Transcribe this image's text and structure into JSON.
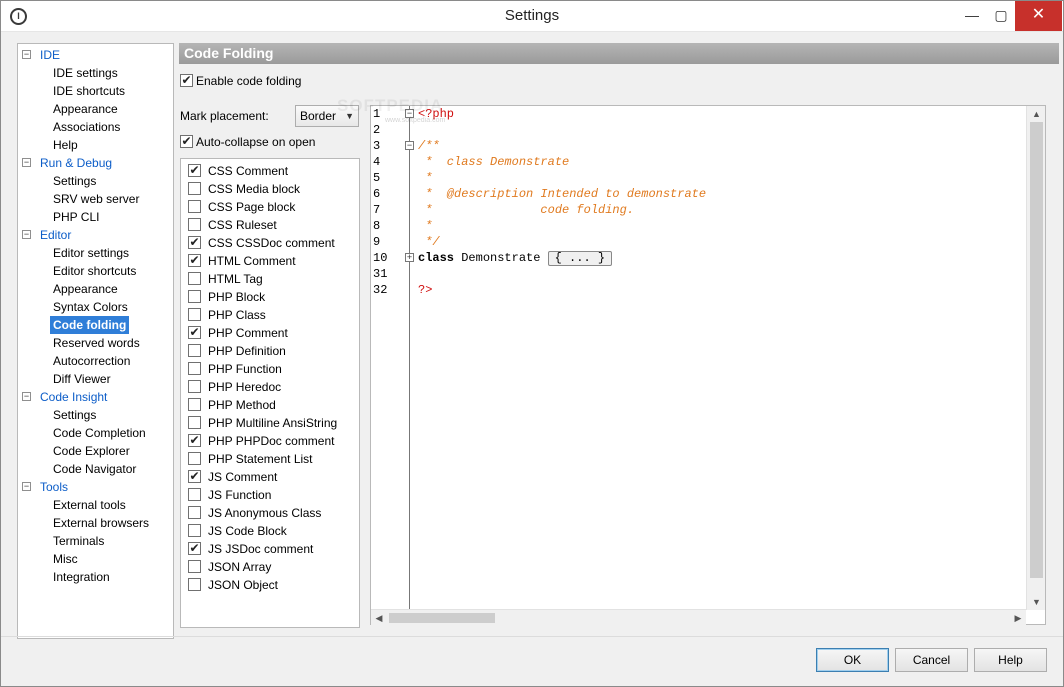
{
  "window": {
    "title": "Settings",
    "app_icon": "app-logo-icon",
    "min_glyph": "—",
    "max_glyph": "▢",
    "close_glyph": "✕"
  },
  "tree": {
    "categories": [
      {
        "label": "IDE",
        "expanded": true,
        "items": [
          "IDE settings",
          "IDE shortcuts",
          "Appearance",
          "Associations",
          "Help"
        ]
      },
      {
        "label": "Run & Debug",
        "expanded": true,
        "items": [
          "Settings",
          "SRV web server",
          "PHP CLI"
        ]
      },
      {
        "label": "Editor",
        "expanded": true,
        "items": [
          "Editor settings",
          "Editor shortcuts",
          "Appearance",
          "Syntax Colors",
          "Code folding",
          "Reserved words",
          "Autocorrection",
          "Diff Viewer"
        ]
      },
      {
        "label": "Code Insight",
        "expanded": true,
        "items": [
          "Settings",
          "Code Completion",
          "Code Explorer",
          "Code Navigator"
        ]
      },
      {
        "label": "Tools",
        "expanded": true,
        "items": [
          "External tools",
          "External browsers",
          "Terminals",
          "Misc",
          "Integration"
        ]
      }
    ],
    "selected": "Code folding"
  },
  "panel": {
    "header": "Code Folding",
    "enable_label": "Enable code folding",
    "enable_checked": true,
    "mark_placement_label": "Mark placement:",
    "mark_placement_value": "Border",
    "auto_collapse_label": "Auto-collapse on open",
    "auto_collapse_checked": true,
    "fold_items": [
      {
        "label": "CSS Comment",
        "checked": true
      },
      {
        "label": "CSS Media block",
        "checked": false
      },
      {
        "label": "CSS Page block",
        "checked": false
      },
      {
        "label": "CSS Ruleset",
        "checked": false
      },
      {
        "label": "CSS CSSDoc comment",
        "checked": true
      },
      {
        "label": "HTML Comment",
        "checked": true
      },
      {
        "label": "HTML Tag",
        "checked": false
      },
      {
        "label": "PHP Block",
        "checked": false
      },
      {
        "label": "PHP Class",
        "checked": false
      },
      {
        "label": "PHP Comment",
        "checked": true
      },
      {
        "label": "PHP Definition",
        "checked": false
      },
      {
        "label": "PHP Function",
        "checked": false
      },
      {
        "label": "PHP Heredoc",
        "checked": false
      },
      {
        "label": "PHP Method",
        "checked": false
      },
      {
        "label": "PHP Multiline AnsiString",
        "checked": false
      },
      {
        "label": "PHP PHPDoc comment",
        "checked": true
      },
      {
        "label": "PHP Statement List",
        "checked": false
      },
      {
        "label": "JS Comment",
        "checked": true
      },
      {
        "label": "JS Function",
        "checked": false
      },
      {
        "label": "JS Anonymous Class",
        "checked": false
      },
      {
        "label": "JS Code Block",
        "checked": false
      },
      {
        "label": "JS JSDoc comment",
        "checked": true
      },
      {
        "label": "JSON Array",
        "checked": false
      },
      {
        "label": "JSON Object",
        "checked": false
      }
    ]
  },
  "editor": {
    "lines": [
      {
        "num": "1",
        "fold": "−",
        "parts": [
          {
            "t": "<?php",
            "c": "#d01010"
          }
        ]
      },
      {
        "num": "2",
        "fold": "",
        "parts": []
      },
      {
        "num": "3",
        "fold": "−",
        "parts": [
          {
            "t": "/**",
            "c": "#e07a1f",
            "i": true
          }
        ]
      },
      {
        "num": "4",
        "fold": "",
        "parts": [
          {
            "t": " *  class Demonstrate",
            "c": "#e07a1f",
            "i": true
          }
        ]
      },
      {
        "num": "5",
        "fold": "",
        "parts": [
          {
            "t": " *",
            "c": "#e07a1f",
            "i": true
          }
        ]
      },
      {
        "num": "6",
        "fold": "",
        "parts": [
          {
            "t": " *  @description Intended to demonstrate",
            "c": "#e07a1f",
            "i": true
          }
        ]
      },
      {
        "num": "7",
        "fold": "",
        "parts": [
          {
            "t": " *               code folding.",
            "c": "#e07a1f",
            "i": true
          }
        ]
      },
      {
        "num": "8",
        "fold": "",
        "parts": [
          {
            "t": " *",
            "c": "#e07a1f",
            "i": true
          }
        ]
      },
      {
        "num": "9",
        "fold": "",
        "parts": [
          {
            "t": " */",
            "c": "#e07a1f",
            "i": true
          }
        ]
      },
      {
        "num": "10",
        "fold": "+",
        "parts": [
          {
            "t": "class",
            "c": "#000000",
            "b": true
          },
          {
            "t": " Demonstrate ",
            "c": "#000000"
          }
        ],
        "folded": "{ ... }"
      },
      {
        "num": "31",
        "fold": "",
        "parts": []
      },
      {
        "num": "32",
        "fold": "",
        "parts": [
          {
            "t": "?>",
            "c": "#d01010"
          }
        ]
      }
    ]
  },
  "watermark": {
    "text": "SOFTPEDIA",
    "url": "www.softpedia.com"
  },
  "buttons": {
    "ok": "OK",
    "cancel": "Cancel",
    "help": "Help"
  }
}
